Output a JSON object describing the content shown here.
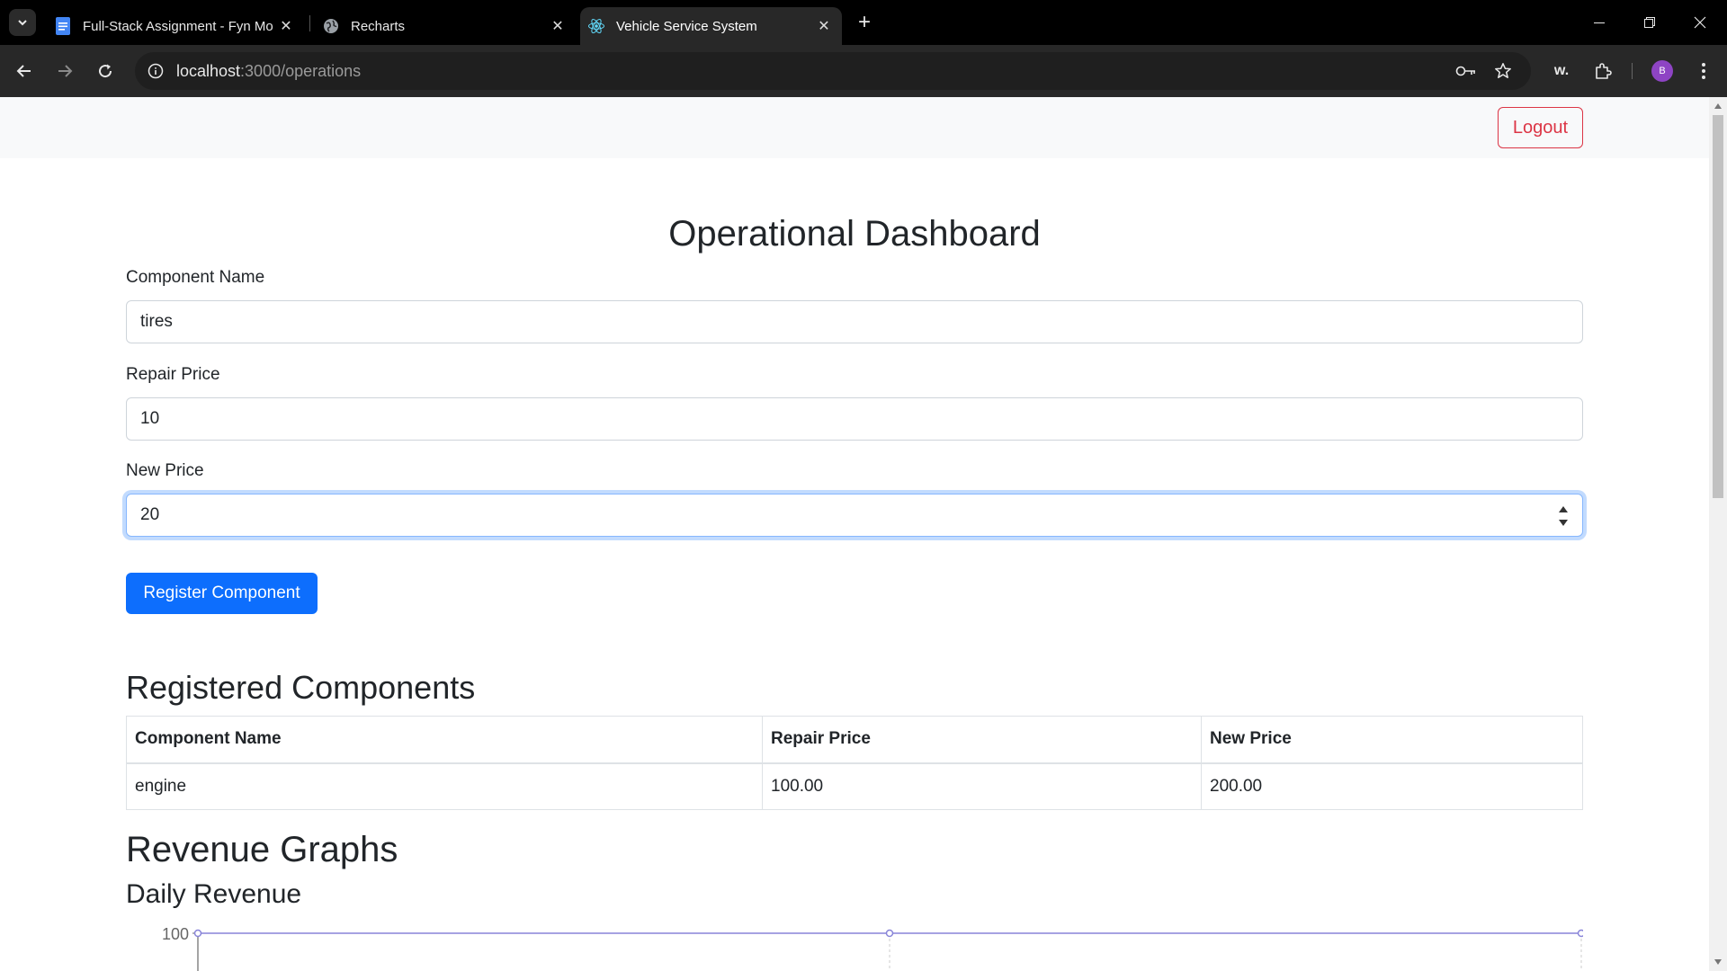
{
  "browser": {
    "tabs": [
      {
        "title": "Full-Stack Assignment - Fyn Mo",
        "icon": "docs-icon"
      },
      {
        "title": "Recharts",
        "icon": "globe-icon"
      },
      {
        "title": "Vehicle Service System",
        "icon": "react-icon",
        "active": true
      }
    ],
    "url_host": "localhost",
    "url_rest": ":3000/operations",
    "profile_initial": "B",
    "extension_label": "w."
  },
  "navbar": {
    "logout_label": "Logout"
  },
  "page": {
    "title": "Operational Dashboard",
    "form": {
      "component_name_label": "Component Name",
      "component_name_value": "tires",
      "repair_price_label": "Repair Price",
      "repair_price_value": "10",
      "new_price_label": "New Price",
      "new_price_value": "20",
      "submit_label": "Register Component"
    },
    "registered": {
      "heading": "Registered Components",
      "columns": [
        "Component Name",
        "Repair Price",
        "New Price"
      ],
      "rows": [
        [
          "engine",
          "100.00",
          "200.00"
        ]
      ]
    },
    "revenue": {
      "heading": "Revenue Graphs",
      "daily_heading": "Daily Revenue"
    }
  },
  "chart_data": {
    "type": "line",
    "title": "Daily Revenue",
    "y_tick_labels": [
      "100"
    ],
    "series": [
      {
        "values": [
          100,
          100,
          100
        ]
      }
    ],
    "line_color": "#8884d8"
  },
  "colors": {
    "primary": "#0d6efd",
    "danger": "#dc3545",
    "focus_border": "#86b7fe"
  }
}
